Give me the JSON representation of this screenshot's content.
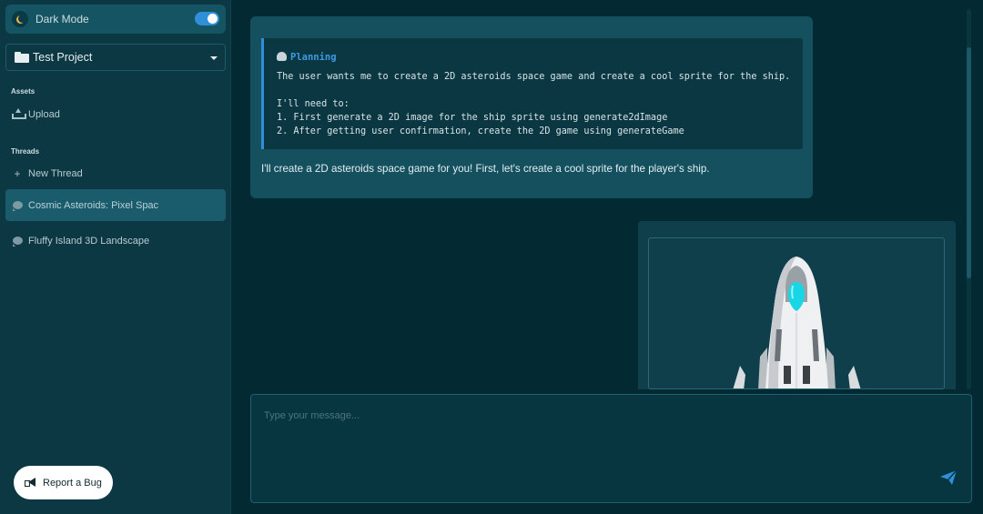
{
  "sidebar": {
    "dark_mode_label": "Dark Mode",
    "dark_mode_on": true,
    "project": "Test Project",
    "assets_heading": "Assets",
    "upload_label": "Upload",
    "threads_heading": "Threads",
    "new_thread_label": "New Thread",
    "threads": [
      {
        "label": "Cosmic Asteroids: Pixel Spac",
        "active": true
      },
      {
        "label": "Fluffy Island 3D Landscape",
        "active": false
      }
    ],
    "report_bug_label": "Report a Bug"
  },
  "chat": {
    "planning": {
      "title": "Planning",
      "lines": [
        "The user wants me to create a 2D asteroids space game and create a cool sprite for the ship.",
        "",
        "I'll need to:",
        "1. First generate a 2D image for the ship sprite using generate2dImage",
        "2. After getting user confirmation, create the 2D game using generateGame"
      ]
    },
    "assistant_text": "I'll create a 2D asteroids space game for you! First, let's create a cool sprite for the player's ship.",
    "image_alt": "Spaceship sprite"
  },
  "composer": {
    "placeholder": "Type your message..."
  },
  "colors": {
    "accent": "#2f8fd8",
    "sidebar_bg": "#0b3843",
    "main_bg": "#032a33"
  },
  "icons": [
    "moon-icon",
    "folder-icon",
    "chevron-down-icon",
    "upload-icon",
    "plus-icon",
    "chat-bubble-icon",
    "brain-icon",
    "megaphone-icon",
    "send-icon"
  ]
}
